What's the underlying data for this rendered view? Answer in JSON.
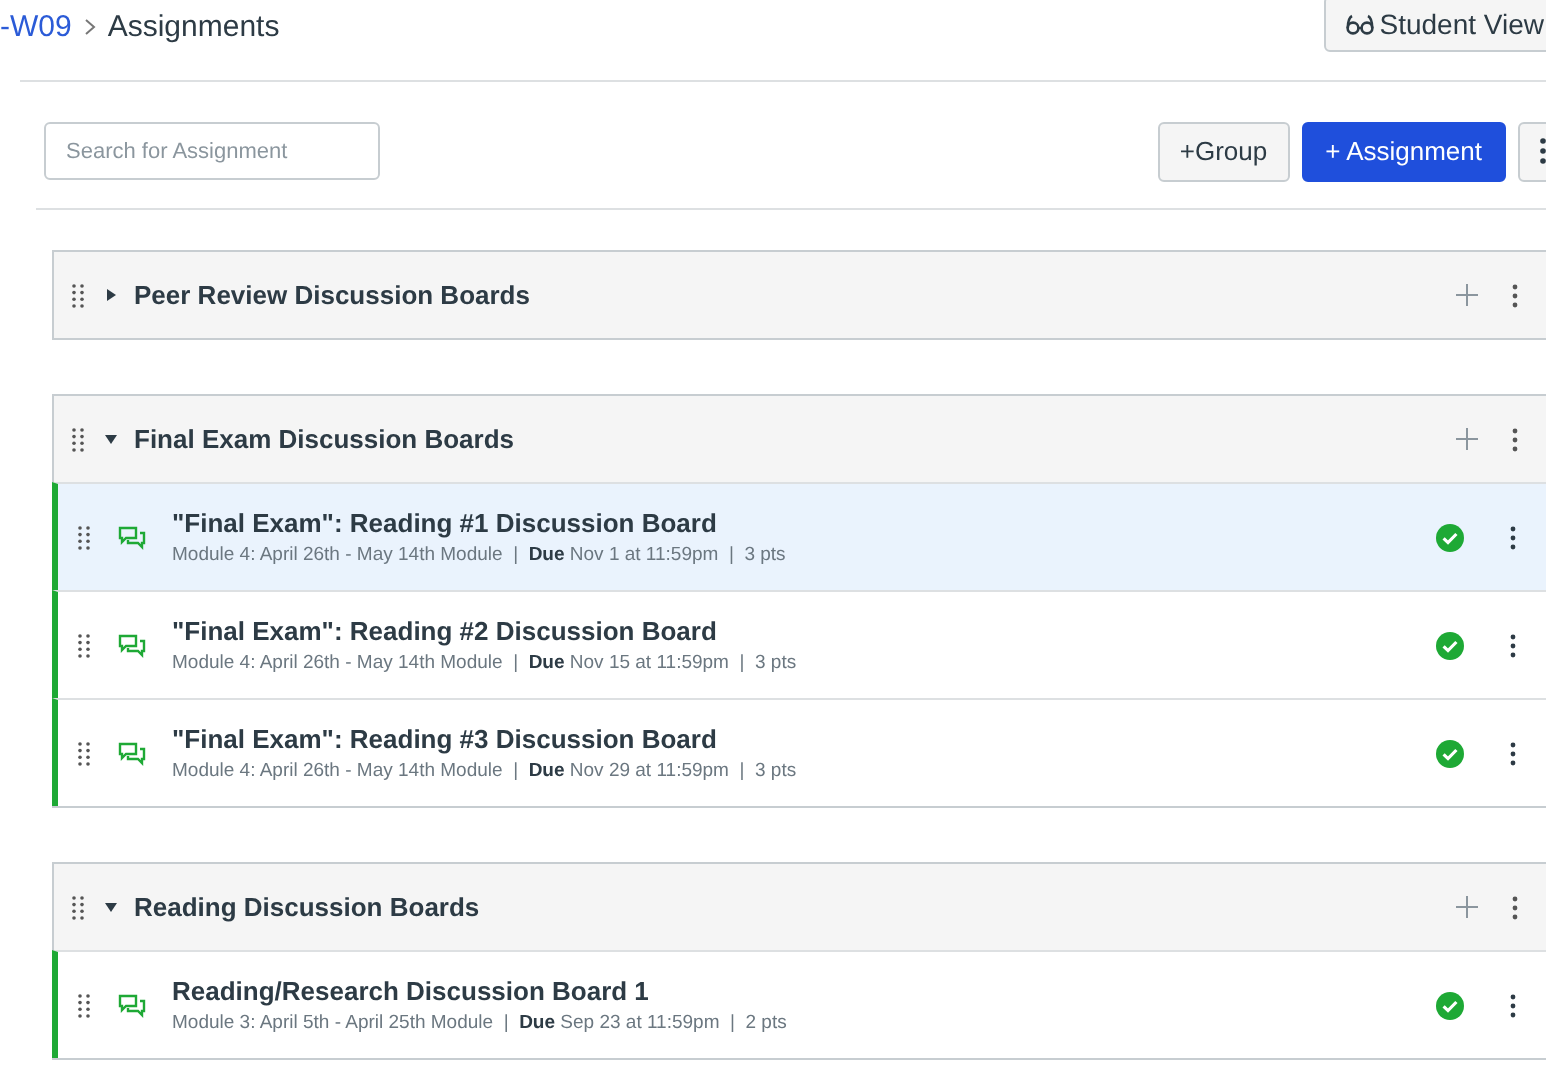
{
  "breadcrumb": [
    {
      "label": "-W09",
      "kind": "link"
    },
    {
      "label": "Assignments",
      "kind": "current"
    }
  ],
  "student_view_button": {
    "label": "Student View"
  },
  "search": {
    "placeholder": "Search for Assignment"
  },
  "buttons": [
    {
      "label": "+Group",
      "kind": "secondary"
    },
    {
      "label": "+ Assignment",
      "kind": "primary"
    }
  ],
  "groups": [
    {
      "title": "Peer Review Discussion Boards",
      "expanded": false
    },
    {
      "title": "Final Exam Discussion Boards",
      "expanded": true,
      "items": [
        {
          "title": "\"Final Exam\": Reading #1 Discussion Board",
          "meta": "Module 4: April 26th - May 14th Module  |  **Due** Nov 1 at 11:59pm  |  3 pts",
          "selected": true,
          "published": true
        },
        {
          "title": "\"Final Exam\": Reading #2 Discussion Board",
          "meta": "Module 4: April 26th - May 14th Module  |  **Due** Nov 15 at 11:59pm  |  3 pts",
          "selected": false,
          "published": true
        },
        {
          "title": "\"Final Exam\": Reading #3 Discussion Board",
          "meta": "Module 4: April 26th - May 14th Module  |  **Due** Nov 29 at 11:59pm  |  3 pts",
          "selected": false,
          "published": true
        }
      ]
    },
    {
      "title": "Reading Discussion Boards",
      "expanded": true,
      "items": [
        {
          "title": "Reading/Research Discussion Board 1",
          "meta": "Module 3: April 5th - April 25th Module  |  **Due** Sep 23 at 11:59pm  |  2 pts",
          "selected": false,
          "published": true
        }
      ]
    }
  ]
}
